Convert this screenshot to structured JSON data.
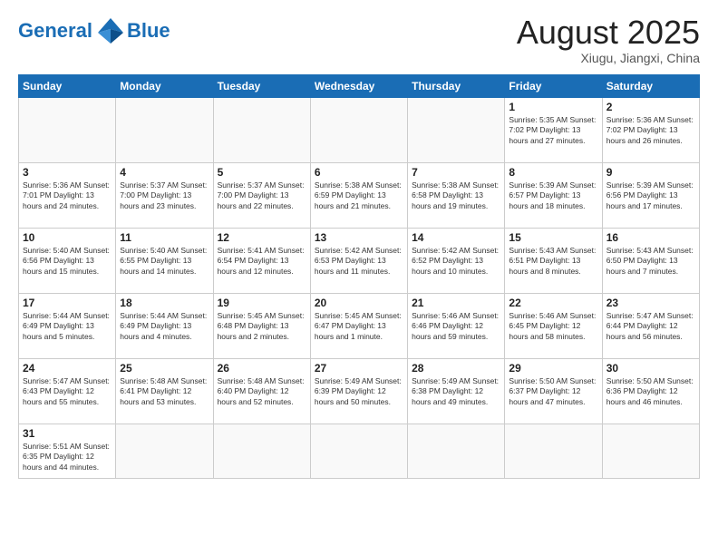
{
  "header": {
    "logo_general": "General",
    "logo_blue": "Blue",
    "month_title": "August 2025",
    "subtitle": "Xiugu, Jiangxi, China"
  },
  "weekdays": [
    "Sunday",
    "Monday",
    "Tuesday",
    "Wednesday",
    "Thursday",
    "Friday",
    "Saturday"
  ],
  "weeks": [
    [
      {
        "day": "",
        "info": ""
      },
      {
        "day": "",
        "info": ""
      },
      {
        "day": "",
        "info": ""
      },
      {
        "day": "",
        "info": ""
      },
      {
        "day": "",
        "info": ""
      },
      {
        "day": "1",
        "info": "Sunrise: 5:35 AM\nSunset: 7:02 PM\nDaylight: 13 hours and 27 minutes."
      },
      {
        "day": "2",
        "info": "Sunrise: 5:36 AM\nSunset: 7:02 PM\nDaylight: 13 hours and 26 minutes."
      }
    ],
    [
      {
        "day": "3",
        "info": "Sunrise: 5:36 AM\nSunset: 7:01 PM\nDaylight: 13 hours and 24 minutes."
      },
      {
        "day": "4",
        "info": "Sunrise: 5:37 AM\nSunset: 7:00 PM\nDaylight: 13 hours and 23 minutes."
      },
      {
        "day": "5",
        "info": "Sunrise: 5:37 AM\nSunset: 7:00 PM\nDaylight: 13 hours and 22 minutes."
      },
      {
        "day": "6",
        "info": "Sunrise: 5:38 AM\nSunset: 6:59 PM\nDaylight: 13 hours and 21 minutes."
      },
      {
        "day": "7",
        "info": "Sunrise: 5:38 AM\nSunset: 6:58 PM\nDaylight: 13 hours and 19 minutes."
      },
      {
        "day": "8",
        "info": "Sunrise: 5:39 AM\nSunset: 6:57 PM\nDaylight: 13 hours and 18 minutes."
      },
      {
        "day": "9",
        "info": "Sunrise: 5:39 AM\nSunset: 6:56 PM\nDaylight: 13 hours and 17 minutes."
      }
    ],
    [
      {
        "day": "10",
        "info": "Sunrise: 5:40 AM\nSunset: 6:56 PM\nDaylight: 13 hours and 15 minutes."
      },
      {
        "day": "11",
        "info": "Sunrise: 5:40 AM\nSunset: 6:55 PM\nDaylight: 13 hours and 14 minutes."
      },
      {
        "day": "12",
        "info": "Sunrise: 5:41 AM\nSunset: 6:54 PM\nDaylight: 13 hours and 12 minutes."
      },
      {
        "day": "13",
        "info": "Sunrise: 5:42 AM\nSunset: 6:53 PM\nDaylight: 13 hours and 11 minutes."
      },
      {
        "day": "14",
        "info": "Sunrise: 5:42 AM\nSunset: 6:52 PM\nDaylight: 13 hours and 10 minutes."
      },
      {
        "day": "15",
        "info": "Sunrise: 5:43 AM\nSunset: 6:51 PM\nDaylight: 13 hours and 8 minutes."
      },
      {
        "day": "16",
        "info": "Sunrise: 5:43 AM\nSunset: 6:50 PM\nDaylight: 13 hours and 7 minutes."
      }
    ],
    [
      {
        "day": "17",
        "info": "Sunrise: 5:44 AM\nSunset: 6:49 PM\nDaylight: 13 hours and 5 minutes."
      },
      {
        "day": "18",
        "info": "Sunrise: 5:44 AM\nSunset: 6:49 PM\nDaylight: 13 hours and 4 minutes."
      },
      {
        "day": "19",
        "info": "Sunrise: 5:45 AM\nSunset: 6:48 PM\nDaylight: 13 hours and 2 minutes."
      },
      {
        "day": "20",
        "info": "Sunrise: 5:45 AM\nSunset: 6:47 PM\nDaylight: 13 hours and 1 minute."
      },
      {
        "day": "21",
        "info": "Sunrise: 5:46 AM\nSunset: 6:46 PM\nDaylight: 12 hours and 59 minutes."
      },
      {
        "day": "22",
        "info": "Sunrise: 5:46 AM\nSunset: 6:45 PM\nDaylight: 12 hours and 58 minutes."
      },
      {
        "day": "23",
        "info": "Sunrise: 5:47 AM\nSunset: 6:44 PM\nDaylight: 12 hours and 56 minutes."
      }
    ],
    [
      {
        "day": "24",
        "info": "Sunrise: 5:47 AM\nSunset: 6:43 PM\nDaylight: 12 hours and 55 minutes."
      },
      {
        "day": "25",
        "info": "Sunrise: 5:48 AM\nSunset: 6:41 PM\nDaylight: 12 hours and 53 minutes."
      },
      {
        "day": "26",
        "info": "Sunrise: 5:48 AM\nSunset: 6:40 PM\nDaylight: 12 hours and 52 minutes."
      },
      {
        "day": "27",
        "info": "Sunrise: 5:49 AM\nSunset: 6:39 PM\nDaylight: 12 hours and 50 minutes."
      },
      {
        "day": "28",
        "info": "Sunrise: 5:49 AM\nSunset: 6:38 PM\nDaylight: 12 hours and 49 minutes."
      },
      {
        "day": "29",
        "info": "Sunrise: 5:50 AM\nSunset: 6:37 PM\nDaylight: 12 hours and 47 minutes."
      },
      {
        "day": "30",
        "info": "Sunrise: 5:50 AM\nSunset: 6:36 PM\nDaylight: 12 hours and 46 minutes."
      }
    ],
    [
      {
        "day": "31",
        "info": "Sunrise: 5:51 AM\nSunset: 6:35 PM\nDaylight: 12 hours and 44 minutes."
      },
      {
        "day": "",
        "info": ""
      },
      {
        "day": "",
        "info": ""
      },
      {
        "day": "",
        "info": ""
      },
      {
        "day": "",
        "info": ""
      },
      {
        "day": "",
        "info": ""
      },
      {
        "day": "",
        "info": ""
      }
    ]
  ]
}
